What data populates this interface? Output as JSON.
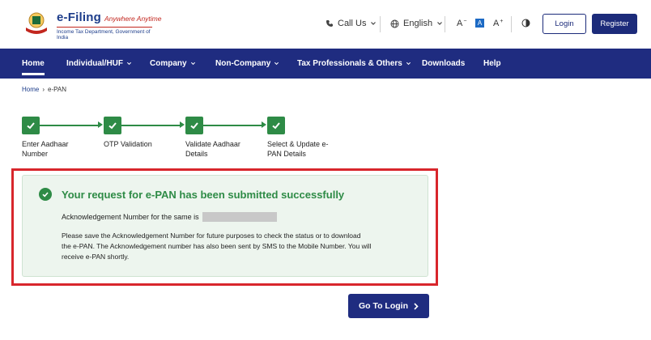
{
  "header": {
    "brand_name": "e-Filing",
    "brand_tagline": "Anywhere Anytime",
    "brand_subtitle": "Income Tax Department, Government of India",
    "call_us": "Call Us",
    "language": "English",
    "font_decrease": "A",
    "font_default": "A",
    "font_increase": "A",
    "login_label": "Login",
    "register_label": "Register"
  },
  "nav": {
    "items": [
      {
        "label": "Home"
      },
      {
        "label": "Individual/HUF"
      },
      {
        "label": "Company"
      },
      {
        "label": "Non-Company"
      },
      {
        "label": "Tax Professionals & Others"
      },
      {
        "label": "Downloads"
      },
      {
        "label": "Help"
      }
    ]
  },
  "breadcrumb": {
    "home": "Home",
    "sep": "›",
    "current": "e-PAN"
  },
  "steps": [
    {
      "label_l1": "Enter Aadhaar",
      "label_l2": "Number"
    },
    {
      "label_l1": "OTP Validation",
      "label_l2": ""
    },
    {
      "label_l1": "Validate Aadhaar",
      "label_l2": "Details"
    },
    {
      "label_l1": "Select & Update e-",
      "label_l2": "PAN Details"
    }
  ],
  "success": {
    "title": "Your request for e-PAN has been submitted successfully",
    "ack_text": "Acknowledgement Number for the same is",
    "info_l1": "Please save the Acknowledgement Number for future purposes to check the status or to download",
    "info_l2": "the e-PAN. The Acknowledgement number has also been sent by SMS to the Mobile Number. You will",
    "info_l3": "receive e-PAN shortly."
  },
  "actions": {
    "go_to_login": "Go To Login"
  },
  "colors": {
    "brand_navy": "#1f2c80",
    "success_green": "#2e8b46",
    "highlight_red": "#d8262c"
  }
}
